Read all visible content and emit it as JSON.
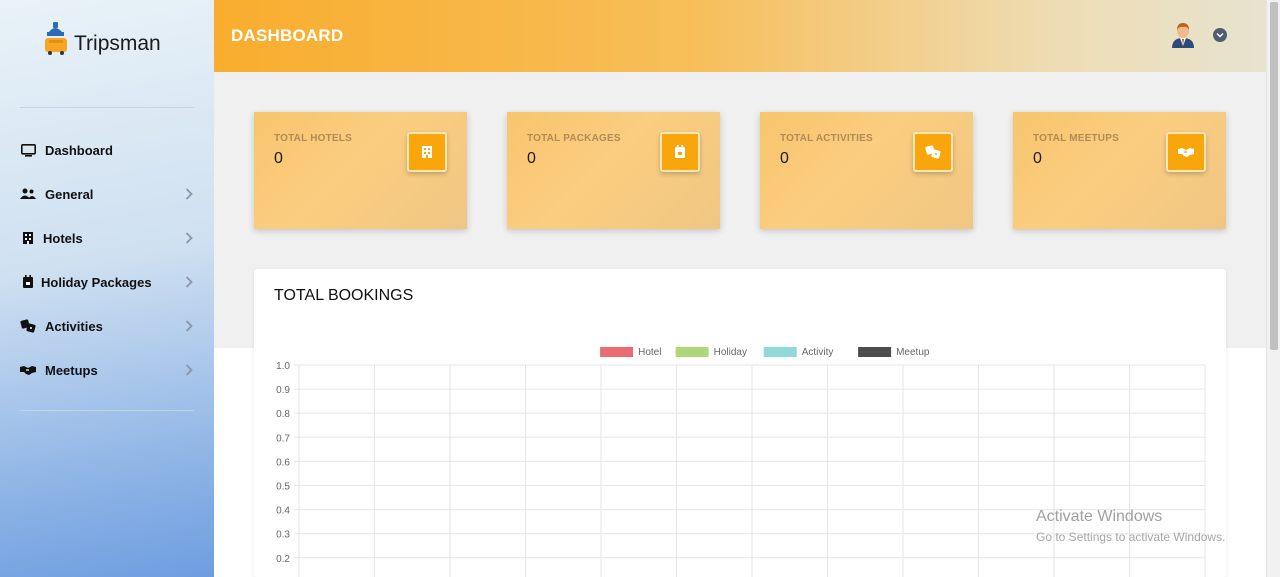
{
  "app": {
    "name": "Tripsman"
  },
  "sidebar": {
    "items": [
      {
        "label": "Dashboard",
        "icon": "monitor-icon"
      },
      {
        "label": "General",
        "icon": "users-icon"
      },
      {
        "label": "Hotels",
        "icon": "hotel-icon"
      },
      {
        "label": "Holiday Packages",
        "icon": "calendar-icon"
      },
      {
        "label": "Activities",
        "icon": "dice-icon"
      },
      {
        "label": "Meetups",
        "icon": "handshake-icon"
      }
    ]
  },
  "header": {
    "title": "DASHBOARD"
  },
  "stats": [
    {
      "label": "TOTAL HOTELS",
      "value": "0",
      "icon": "hotel-icon"
    },
    {
      "label": "TOTAL PACKAGES",
      "value": "0",
      "icon": "calendar-icon"
    },
    {
      "label": "TOTAL ACTIVITIES",
      "value": "0",
      "icon": "dice-icon"
    },
    {
      "label": "TOTAL MEETUPS",
      "value": "0",
      "icon": "handshake-icon"
    }
  ],
  "bookings": {
    "title": "TOTAL BOOKINGS"
  },
  "colors": {
    "accent": "#f8a60c",
    "hotel": "#ec6b73",
    "holiday": "#afd67a",
    "activity": "#8fd9d6",
    "meetup": "#4d4d4d"
  },
  "chart_data": {
    "type": "line",
    "title": "",
    "xlabel": "",
    "ylabel": "",
    "series": [
      {
        "name": "Hotel",
        "values": []
      },
      {
        "name": "Holiday",
        "values": []
      },
      {
        "name": "Activity",
        "values": []
      },
      {
        "name": "Meetup",
        "values": []
      }
    ],
    "y_ticks": [
      "1.0",
      "0.9",
      "0.8",
      "0.7",
      "0.6",
      "0.5",
      "0.4",
      "0.3",
      "0.2"
    ],
    "ylim": [
      0,
      1
    ],
    "grid": true,
    "legend": "top"
  },
  "watermark": {
    "line1": "Activate Windows",
    "line2": "Go to Settings to activate Windows."
  }
}
